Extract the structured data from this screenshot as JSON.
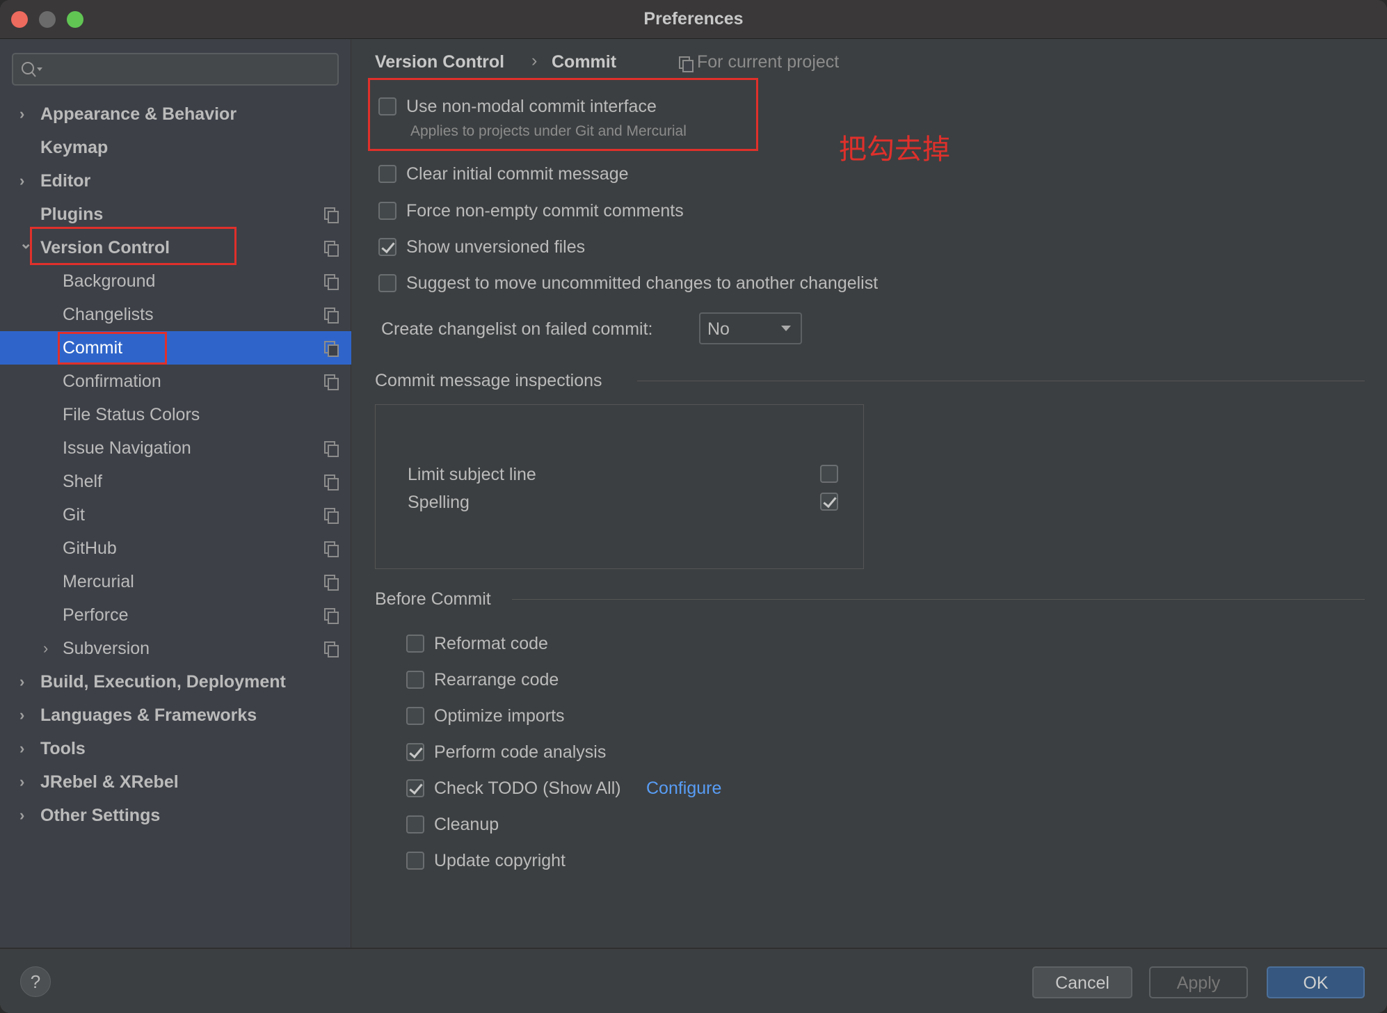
{
  "window": {
    "title": "Preferences"
  },
  "sidebar": {
    "search_placeholder": "",
    "items": [
      {
        "label": "Appearance & Behavior",
        "level": 0,
        "expandable": true
      },
      {
        "label": "Keymap",
        "level": 0
      },
      {
        "label": "Editor",
        "level": 0,
        "expandable": true
      },
      {
        "label": "Plugins",
        "level": 0,
        "project_icon": true
      },
      {
        "label": "Version Control",
        "level": 0,
        "expanded": true,
        "project_icon": true
      },
      {
        "label": "Background",
        "level": 1,
        "project_icon": true
      },
      {
        "label": "Changelists",
        "level": 1,
        "project_icon": true
      },
      {
        "label": "Commit",
        "level": 1,
        "selected": true,
        "project_icon": true
      },
      {
        "label": "Confirmation",
        "level": 1,
        "project_icon": true
      },
      {
        "label": "File Status Colors",
        "level": 1
      },
      {
        "label": "Issue Navigation",
        "level": 1,
        "project_icon": true
      },
      {
        "label": "Shelf",
        "level": 1,
        "project_icon": true
      },
      {
        "label": "Git",
        "level": 1,
        "project_icon": true
      },
      {
        "label": "GitHub",
        "level": 1,
        "project_icon": true
      },
      {
        "label": "Mercurial",
        "level": 1,
        "project_icon": true
      },
      {
        "label": "Perforce",
        "level": 1,
        "project_icon": true
      },
      {
        "label": "Subversion",
        "level": 1,
        "expandable": true,
        "project_icon": true
      },
      {
        "label": "Build, Execution, Deployment",
        "level": 0,
        "expandable": true
      },
      {
        "label": "Languages & Frameworks",
        "level": 0,
        "expandable": true
      },
      {
        "label": "Tools",
        "level": 0,
        "expandable": true
      },
      {
        "label": "JRebel & XRebel",
        "level": 0,
        "expandable": true
      },
      {
        "label": "Other Settings",
        "level": 0,
        "expandable": true
      }
    ]
  },
  "breadcrumb": {
    "parent": "Version Control",
    "current": "Commit",
    "scope": "For current project"
  },
  "options": {
    "non_modal": {
      "label": "Use non-modal commit interface",
      "hint": "Applies to projects under Git and Mercurial",
      "checked": false
    },
    "list": [
      {
        "label": "Clear initial commit message",
        "checked": false
      },
      {
        "label": "Force non-empty commit comments",
        "checked": false
      },
      {
        "label": "Show unversioned files",
        "checked": true
      },
      {
        "label": "Suggest to move uncommitted changes to another changelist",
        "checked": false
      }
    ],
    "changelist_label": "Create changelist on failed commit:",
    "changelist_value": "No"
  },
  "annotation": "把勾去掉",
  "inspections": {
    "title": "Commit message inspections",
    "items": [
      {
        "label": "Limit subject line",
        "checked": false
      },
      {
        "label": "Spelling",
        "checked": true
      }
    ]
  },
  "before_commit": {
    "title": "Before Commit",
    "items": [
      {
        "label": "Reformat code",
        "checked": false
      },
      {
        "label": "Rearrange code",
        "checked": false
      },
      {
        "label": "Optimize imports",
        "checked": false
      },
      {
        "label": "Perform code analysis",
        "checked": true
      },
      {
        "label": "Check TODO (Show All)",
        "checked": true,
        "link": "Configure"
      },
      {
        "label": "Cleanup",
        "checked": false
      },
      {
        "label": "Update copyright",
        "checked": false
      }
    ]
  },
  "footer": {
    "help": "?",
    "cancel": "Cancel",
    "apply": "Apply",
    "ok": "OK"
  },
  "colors": {
    "accent": "#2f65ca",
    "link": "#589df6",
    "annotation": "#e0302b"
  }
}
